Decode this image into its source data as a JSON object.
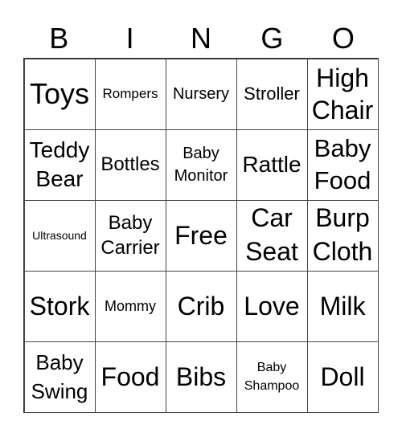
{
  "header": [
    "B",
    "I",
    "N",
    "G",
    "O"
  ],
  "cells": [
    "Toys",
    "Rompers",
    "Nursery",
    "Stroller",
    "High Chair",
    "Teddy Bear",
    "Bottles",
    "Baby Monitor",
    "Rattle",
    "Baby Food",
    "Ultrasound",
    "Baby Carrier",
    "Free",
    "Car Seat",
    "Burp Cloth",
    "Stork",
    "Mommy",
    "Crib",
    "Love",
    "Milk",
    "Baby Swing",
    "Food",
    "Bibs",
    "Baby Shampoo",
    "Doll"
  ]
}
